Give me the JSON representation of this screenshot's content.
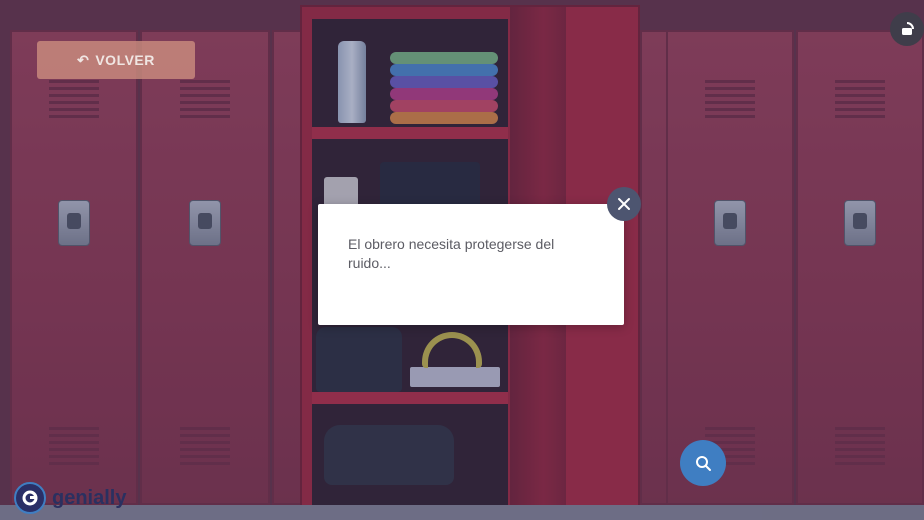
{
  "header": {
    "back_button_label": "VOLVER",
    "back_icon": "undo-arrow-icon",
    "top_right_icon": "rotate-device-icon"
  },
  "modal": {
    "text": "El obrero necesita protegerse del ruido...",
    "close_icon": "close-icon"
  },
  "search_button": {
    "icon": "search-icon"
  },
  "brand": {
    "name": "genially",
    "icon": "genially-logo-icon"
  },
  "colors": {
    "overlay": "#3a3e70",
    "back_button": "#ce8f80",
    "modal_background": "#ffffff",
    "close_button": "#4d5570",
    "search_button": "#3f7ec2",
    "locker_red": "#b01e2d"
  }
}
